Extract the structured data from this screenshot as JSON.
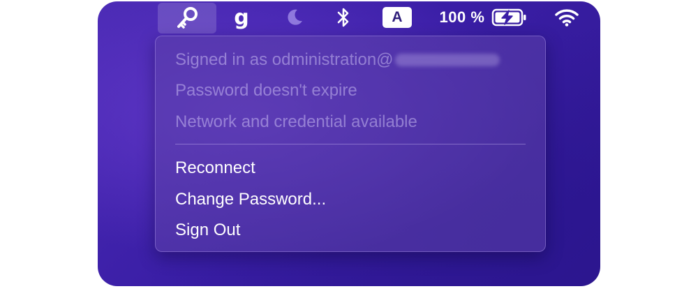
{
  "menubar": {
    "icons": [
      "key-icon",
      "g-dollar-icon",
      "moon-icon",
      "bluetooth-icon",
      "input-source-icon",
      "battery-charging-icon",
      "wifi-icon"
    ],
    "g_glyph": "g",
    "input_source": "A",
    "battery_percent": "100 %"
  },
  "menu": {
    "status_items": [
      {
        "label": "Signed in as odministration@"
      },
      {
        "label": "Password doesn't expire"
      },
      {
        "label": "Network and credential available"
      }
    ],
    "action_items": [
      {
        "label": "Reconnect"
      },
      {
        "label": "Change Password..."
      },
      {
        "label": "Sign Out"
      }
    ]
  },
  "colors": {
    "desktop_accent": "#3a1ea6",
    "menu_text_enabled": "#ffffff",
    "menu_text_disabled": "#a99bd9"
  }
}
